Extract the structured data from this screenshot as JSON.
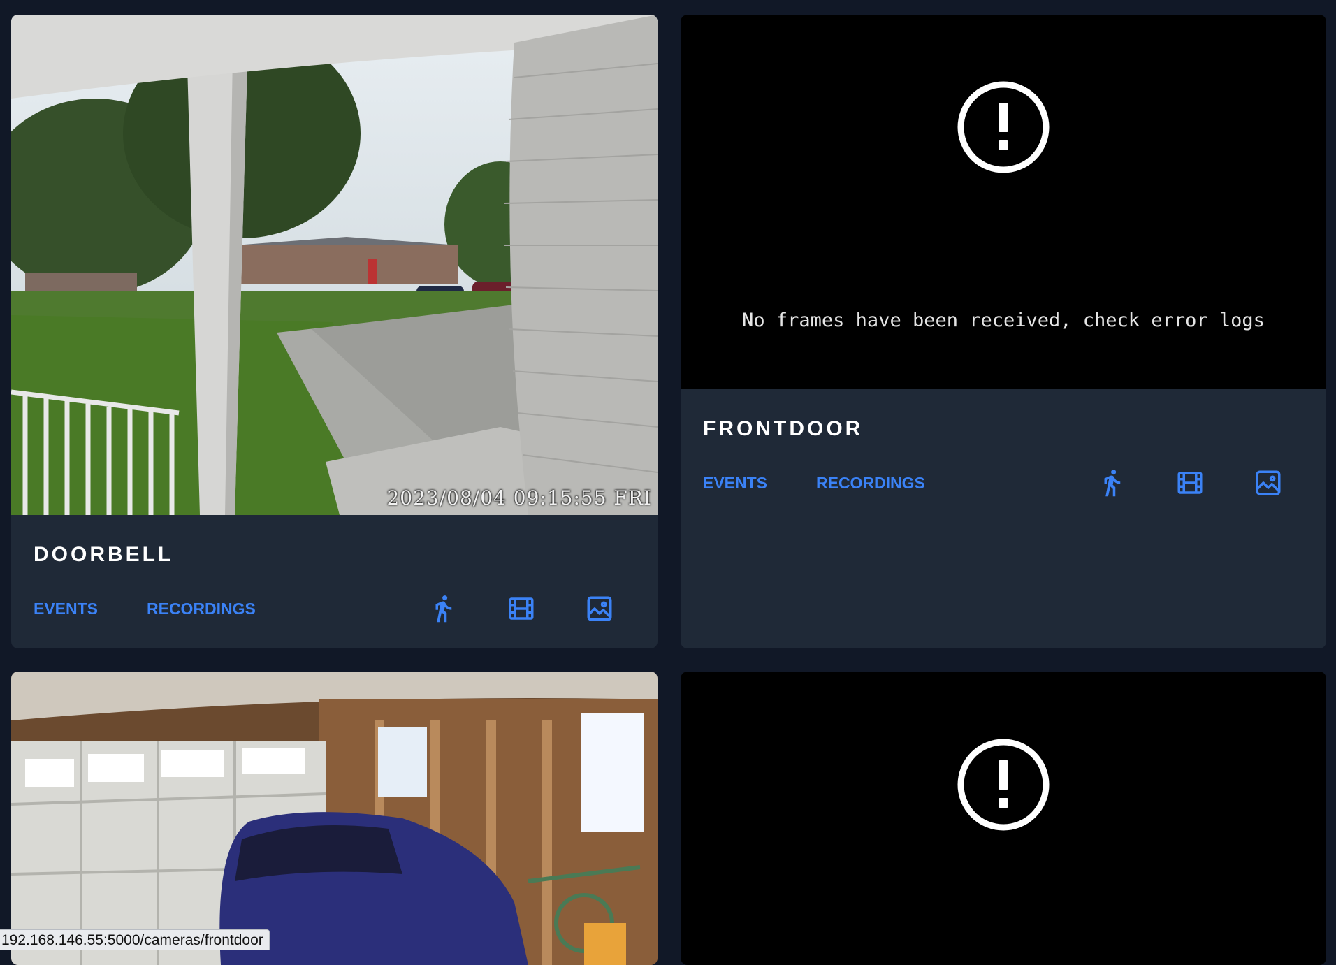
{
  "cameras": [
    {
      "name": "doorbell",
      "status": "live",
      "timestamp": "2023/08/04 09:15:55 FRI",
      "links": {
        "events": "Events",
        "recordings": "Recordings"
      },
      "icons": [
        "motion-walk-icon",
        "film-clips-icon",
        "image-snapshot-icon"
      ]
    },
    {
      "name": "frontdoor",
      "status": "error",
      "error_message": "No frames have been received, check error logs",
      "links": {
        "events": "Events",
        "recordings": "Recordings"
      },
      "icons": [
        "motion-walk-icon",
        "film-clips-icon",
        "image-snapshot-icon"
      ]
    },
    {
      "status": "live"
    },
    {
      "status": "error"
    }
  ],
  "status_bar": {
    "url": "192.168.146.55:5000/cameras/frontdoor"
  },
  "colors": {
    "page_bg": "#111827",
    "card_bg": "#1f2937",
    "accent": "#3b82f6",
    "title": "#ffffff"
  }
}
